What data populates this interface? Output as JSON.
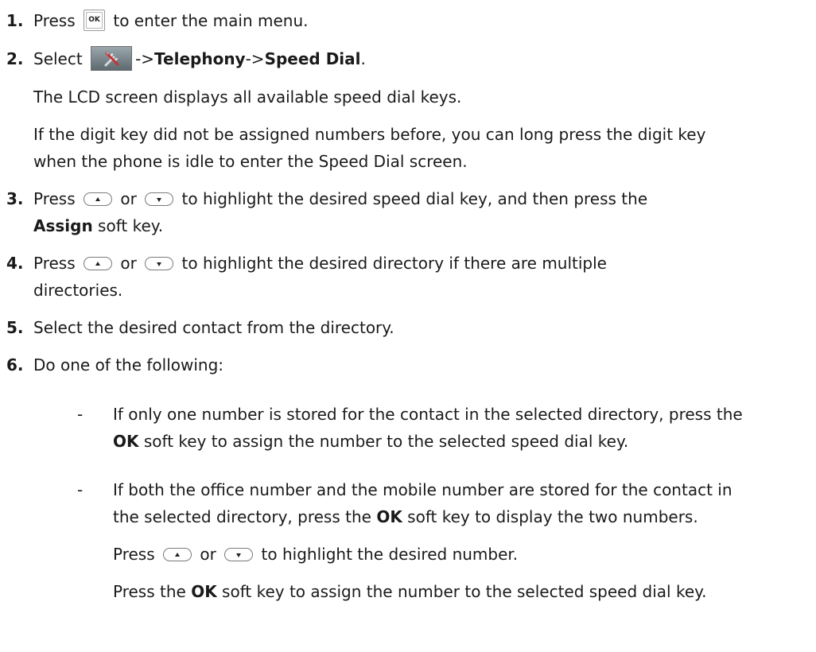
{
  "steps": [
    {
      "num": "1.",
      "pre": "Press",
      "post": "to enter the main menu.",
      "icon_label": "OK"
    },
    {
      "num": "2.",
      "pre": "Select",
      "arrow1": "->",
      "bold1": "Telephony",
      "arrow2": "->",
      "bold2": "Speed Dial",
      "post": "."
    },
    {
      "num": "3.",
      "pre": "Press",
      "or": "or",
      "post": "to highlight the desired speed dial key, and then press the",
      "line2_bold": "Assign",
      "line2_post": " soft key."
    },
    {
      "num": "4.",
      "pre": "Press",
      "or": "or",
      "post": "to highlight the desired directory if there are multiple",
      "line2": "directories."
    },
    {
      "num": "5.",
      "text": "Select the desired contact from the directory."
    },
    {
      "num": "6.",
      "text": "Do one of the following:"
    }
  ],
  "step2_notes": [
    "The LCD screen displays all available speed dial keys.",
    "If the digit key did not be assigned numbers before, you can long press the digit key",
    "when the phone is idle to enter the Speed Dial screen."
  ],
  "bullets": [
    {
      "dash": "-",
      "line1": "If only one number is stored for the contact in the selected directory, press the",
      "line2_bold": "OK",
      "line2_post": " soft key to assign the number to the selected speed dial key."
    },
    {
      "dash": "-",
      "line1": "If both the office number and the mobile number are stored for the contact in",
      "line2_pre": "the selected directory, press the ",
      "line2_bold": "OK",
      "line2_post": " soft key to display the two numbers.",
      "line3_pre": "Press",
      "line3_or": "or",
      "line3_post": "to highlight the desired number.",
      "line4_pre": "Press the ",
      "line4_bold": "OK",
      "line4_post": " soft key to assign the number to the selected speed dial key."
    }
  ],
  "icons": {
    "ok_key": "ok-key-icon",
    "settings": "tools-icon",
    "up": "up-arrow-key-icon",
    "down": "down-arrow-key-icon"
  }
}
